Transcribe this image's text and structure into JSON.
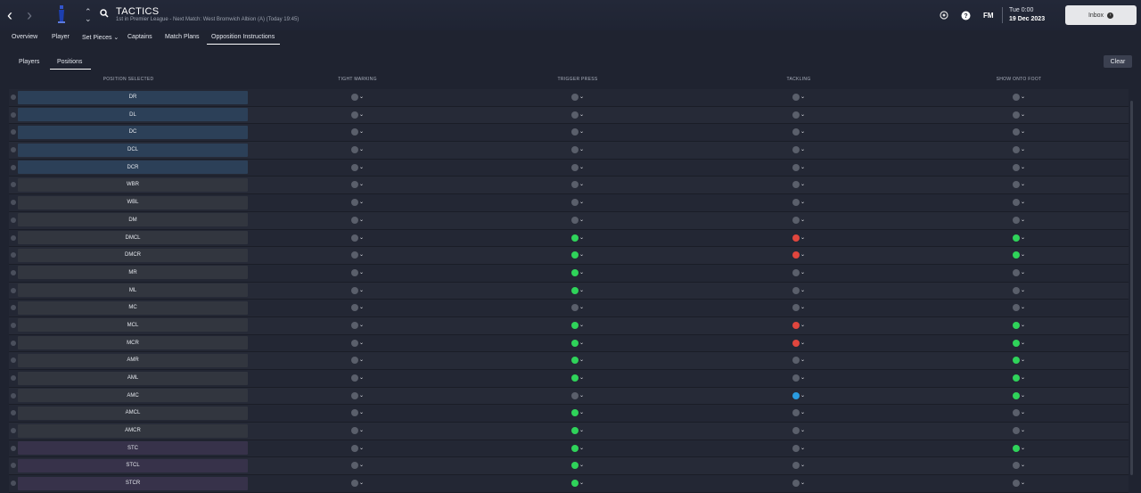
{
  "header": {
    "title": "TACTICS",
    "subtitle": "1st in Premier League - Next Match: West Bromwich Albion (A) (Today 19:45)",
    "brand": "FM",
    "time": "Tue 0:00",
    "date": "19 Dec 2023",
    "inbox_label": "Inbox"
  },
  "tabs": [
    "Overview",
    "Player",
    "Set Pieces",
    "Captains",
    "Match Plans",
    "Opposition Instructions"
  ],
  "active_tab": "Opposition Instructions",
  "subtabs": [
    "Players",
    "Positions"
  ],
  "active_subtab": "Positions",
  "clear_label": "Clear",
  "columns": {
    "position": "POSITION SELECTED",
    "tight_marking": "TIGHT MARKING",
    "trigger_press": "TRIGGER PRESS",
    "tackling": "TACKLING",
    "show_onto_foot": "SHOW ONTO FOOT"
  },
  "colors": {
    "green": "#2fd35a",
    "red": "#e0463e",
    "blue": "#2a9be0",
    "grey": "#5a5f6b"
  },
  "rows": [
    {
      "pos": "DR",
      "group": "def",
      "tight": "grey",
      "press": "grey",
      "tackle": "grey",
      "foot": "grey"
    },
    {
      "pos": "DL",
      "group": "def",
      "tight": "grey",
      "press": "grey",
      "tackle": "grey",
      "foot": "grey"
    },
    {
      "pos": "DC",
      "group": "def",
      "tight": "grey",
      "press": "grey",
      "tackle": "grey",
      "foot": "grey"
    },
    {
      "pos": "DCL",
      "group": "def",
      "tight": "grey",
      "press": "grey",
      "tackle": "grey",
      "foot": "grey"
    },
    {
      "pos": "DCR",
      "group": "def",
      "tight": "grey",
      "press": "grey",
      "tackle": "grey",
      "foot": "grey"
    },
    {
      "pos": "WBR",
      "group": "mid",
      "tight": "grey",
      "press": "grey",
      "tackle": "grey",
      "foot": "grey"
    },
    {
      "pos": "WBL",
      "group": "mid",
      "tight": "grey",
      "press": "grey",
      "tackle": "grey",
      "foot": "grey"
    },
    {
      "pos": "DM",
      "group": "mid",
      "tight": "grey",
      "press": "grey",
      "tackle": "grey",
      "foot": "grey"
    },
    {
      "pos": "DMCL",
      "group": "mid",
      "tight": "grey",
      "press": "green",
      "tackle": "red",
      "foot": "green"
    },
    {
      "pos": "DMCR",
      "group": "mid",
      "tight": "grey",
      "press": "green",
      "tackle": "red",
      "foot": "green"
    },
    {
      "pos": "MR",
      "group": "mid",
      "tight": "grey",
      "press": "green",
      "tackle": "grey",
      "foot": "grey"
    },
    {
      "pos": "ML",
      "group": "mid",
      "tight": "grey",
      "press": "green",
      "tackle": "grey",
      "foot": "grey"
    },
    {
      "pos": "MC",
      "group": "mid",
      "tight": "grey",
      "press": "grey",
      "tackle": "grey",
      "foot": "grey"
    },
    {
      "pos": "MCL",
      "group": "mid",
      "tight": "grey",
      "press": "green",
      "tackle": "red",
      "foot": "green"
    },
    {
      "pos": "MCR",
      "group": "mid",
      "tight": "grey",
      "press": "green",
      "tackle": "red",
      "foot": "green"
    },
    {
      "pos": "AMR",
      "group": "mid",
      "tight": "grey",
      "press": "green",
      "tackle": "grey",
      "foot": "green"
    },
    {
      "pos": "AML",
      "group": "mid",
      "tight": "grey",
      "press": "green",
      "tackle": "grey",
      "foot": "green"
    },
    {
      "pos": "AMC",
      "group": "mid",
      "tight": "grey",
      "press": "grey",
      "tackle": "blue",
      "foot": "green"
    },
    {
      "pos": "AMCL",
      "group": "mid",
      "tight": "grey",
      "press": "green",
      "tackle": "grey",
      "foot": "grey"
    },
    {
      "pos": "AMCR",
      "group": "mid",
      "tight": "grey",
      "press": "green",
      "tackle": "grey",
      "foot": "grey"
    },
    {
      "pos": "STC",
      "group": "att",
      "tight": "grey",
      "press": "green",
      "tackle": "grey",
      "foot": "green"
    },
    {
      "pos": "STCL",
      "group": "att",
      "tight": "grey",
      "press": "green",
      "tackle": "grey",
      "foot": "grey"
    },
    {
      "pos": "STCR",
      "group": "att",
      "tight": "grey",
      "press": "green",
      "tackle": "grey",
      "foot": "grey"
    }
  ]
}
